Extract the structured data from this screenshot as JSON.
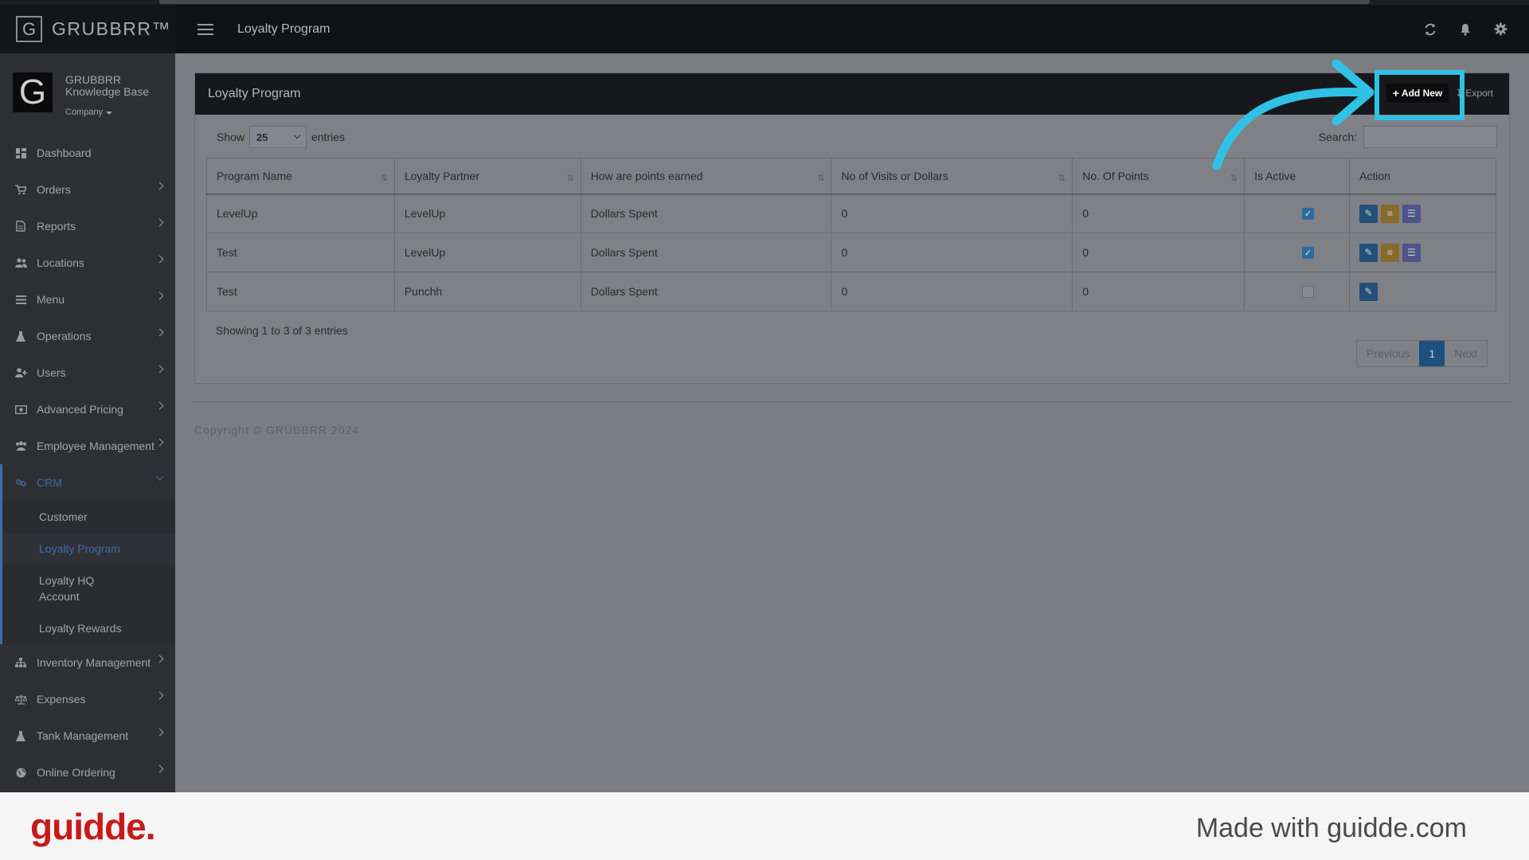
{
  "app": {
    "brand": "GRUBBRR™",
    "brand_letter": "G",
    "header_title": "Loyalty Program"
  },
  "profile": {
    "line1": "GRUBBRR",
    "line2": "Knowledge Base",
    "company": "Company"
  },
  "sidebar": {
    "items": [
      {
        "label": "Dashboard",
        "icon": "dashboard-icon"
      },
      {
        "label": "Orders",
        "icon": "cart-icon"
      },
      {
        "label": "Reports",
        "icon": "document-icon"
      },
      {
        "label": "Locations",
        "icon": "users-icon"
      },
      {
        "label": "Menu",
        "icon": "list-icon"
      },
      {
        "label": "Operations",
        "icon": "flask-icon"
      },
      {
        "label": "Users",
        "icon": "add-user-icon"
      },
      {
        "label": "Advanced Pricing",
        "icon": "money-icon"
      },
      {
        "label": "Employee Management",
        "icon": "group-icon"
      },
      {
        "label": "CRM",
        "icon": "link-icon"
      },
      {
        "label": "Inventory Management",
        "icon": "sitemap-icon"
      },
      {
        "label": "Expenses",
        "icon": "scale-icon"
      },
      {
        "label": "Tank Management",
        "icon": "flask-icon"
      },
      {
        "label": "Online Ordering",
        "icon": "globe-icon"
      }
    ],
    "crm_sub": [
      "Customer",
      "Loyalty Program",
      "Loyalty HQ Account",
      "Loyalty Rewards"
    ]
  },
  "panel": {
    "title": "Loyalty Program",
    "add_label": "Add New",
    "export_label": "Export",
    "show_label": "Show",
    "entries_value": "25",
    "entries_label": "entries",
    "search_label": "Search:",
    "search_value": ""
  },
  "table": {
    "columns": [
      "Program Name",
      "Loyalty Partner",
      "How are points earned",
      "No of Visits or Dollars",
      "No. Of Points",
      "Is Active",
      "Action"
    ],
    "rows": [
      {
        "name": "LevelUp",
        "partner": "LevelUp",
        "earned": "Dollars Spent",
        "visits": "0",
        "points": "0",
        "active": true
      },
      {
        "name": "Test",
        "partner": "LevelUp",
        "earned": "Dollars Spent",
        "visits": "0",
        "points": "0",
        "active": true
      },
      {
        "name": "Test",
        "partner": "Punchh",
        "earned": "Dollars Spent",
        "visits": "0",
        "points": "0",
        "active": false
      }
    ],
    "info": "Showing 1 to 3 of 3 entries",
    "pager": {
      "previous": "Previous",
      "current": "1",
      "next": "Next"
    }
  },
  "copyright": "Copyright © GRUBBRR 2024",
  "footer": {
    "logo": "guidde.",
    "made_with": "Made with guidde.com"
  },
  "colors": {
    "accent": "#3b6ea8",
    "highlight": "#2fc1e6",
    "logo": "#c81a1a"
  }
}
